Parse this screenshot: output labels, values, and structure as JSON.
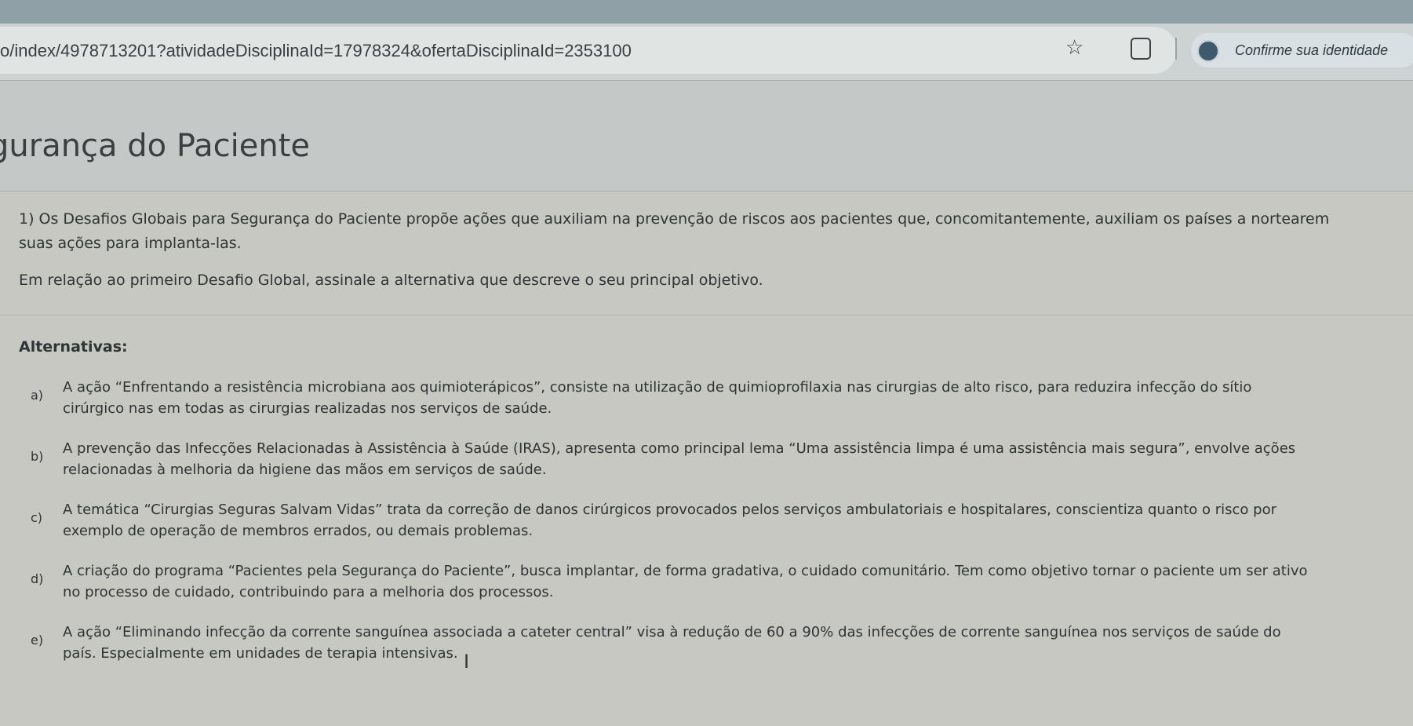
{
  "browser": {
    "url": "o/index/4978713201?atividadeDisciplinaId=17978324&ofertaDisciplinaId=2353100",
    "profile_label": "Confirme sua identidade",
    "icons": [
      "star-icon",
      "extension-icon",
      "profile-avatar-icon"
    ]
  },
  "page": {
    "title": "gurança do Paciente"
  },
  "question": {
    "text_line1": "1)  Os Desafios Globais para Segurança do Paciente propõe ações que auxiliam na prevenção de riscos aos pacientes que, concomitantemente, auxiliam os países a nortearem",
    "text_line2": "suas ações para implanta-las.",
    "instruction": "Em relação ao primeiro Desafio Global, assinale a alternativa que descreve o seu principal objetivo.",
    "alternatives_heading": "Alternativas:",
    "alternatives": [
      {
        "letter": "a)",
        "line1": "A ação “Enfrentando a resistência microbiana aos quimioterápicos”, consiste na utilização de quimioprofilaxia nas cirurgias de alto risco, para reduzira infecção do sítio",
        "line2": "cirúrgico nas em todas as cirurgias realizadas nos serviços de saúde."
      },
      {
        "letter": "b)",
        "line1": "A prevenção das Infecções Relacionadas à Assistência à Saúde (IRAS), apresenta como principal lema “Uma assistência limpa é uma assistência mais segura”, envolve ações",
        "line2": "relacionadas à melhoria da higiene das mãos em serviços de saúde."
      },
      {
        "letter": "c)",
        "line1": "A temática “Cirurgias Seguras Salvam Vidas” trata da correção de danos cirúrgicos provocados pelos serviços ambulatoriais e hospitalares, conscientiza quanto o risco por",
        "line2": "exemplo de operação de membros errados, ou demais problemas."
      },
      {
        "letter": "d)",
        "line1": "A criação do programa “Pacientes pela Segurança do Paciente”, busca implantar, de forma gradativa, o cuidado comunitário. Tem como objetivo tornar o paciente um ser ativo",
        "line2": "no processo de cuidado, contribuindo para a melhoria dos processos."
      },
      {
        "letter": "e)",
        "line1": "A ação “Eliminando infecção da corrente sanguínea associada a cateter central” visa à redução de 60 a 90% das infecções de corrente sanguínea nos serviços de saúde do",
        "line2": "país.  Especialmente em unidades de terapia intensivas."
      }
    ]
  }
}
